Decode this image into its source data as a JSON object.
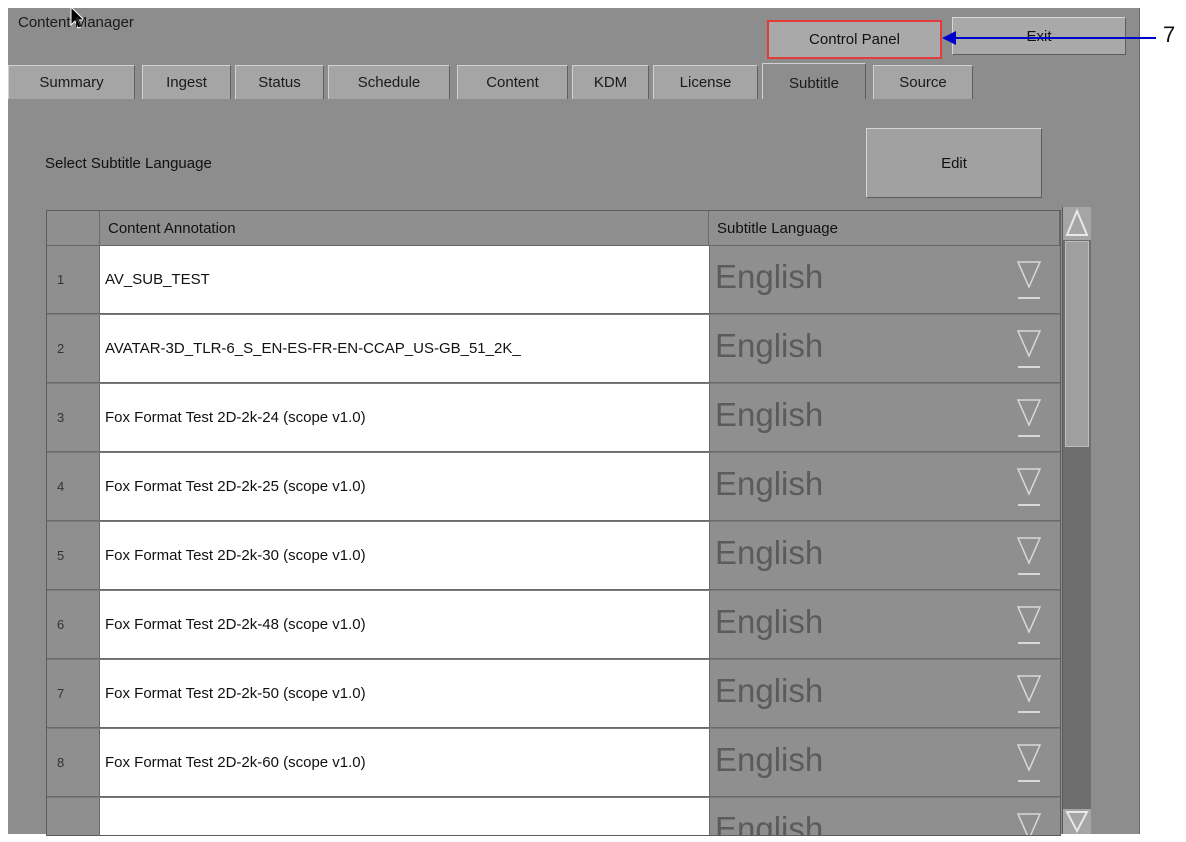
{
  "app": {
    "title": "Content Manager"
  },
  "header_buttons": {
    "control_panel": "Control Panel",
    "exit": "Exit"
  },
  "tabs": [
    {
      "label": "Summary",
      "active": false
    },
    {
      "label": "Ingest",
      "active": false
    },
    {
      "label": "Status",
      "active": false
    },
    {
      "label": "Schedule",
      "active": false
    },
    {
      "label": "Content",
      "active": false
    },
    {
      "label": "KDM",
      "active": false
    },
    {
      "label": "License",
      "active": false
    },
    {
      "label": "Subtitle",
      "active": true
    },
    {
      "label": "Source",
      "active": false
    }
  ],
  "subtitle_panel": {
    "section_label": "Select Subtitle Language",
    "edit_label": "Edit",
    "columns": {
      "annotation": "Content Annotation",
      "language": "Subtitle Language"
    },
    "rows": [
      {
        "num": "1",
        "annotation": "AV_SUB_TEST",
        "language": "English"
      },
      {
        "num": "2",
        "annotation": "AVATAR-3D_TLR-6_S_EN-ES-FR-EN-CCAP_US-GB_51_2K_",
        "language": "English"
      },
      {
        "num": "3",
        "annotation": "Fox Format Test 2D-2k-24 (scope v1.0)",
        "language": "English"
      },
      {
        "num": "4",
        "annotation": "Fox Format Test 2D-2k-25 (scope v1.0)",
        "language": "English"
      },
      {
        "num": "5",
        "annotation": "Fox Format Test 2D-2k-30 (scope v1.0)",
        "language": "English"
      },
      {
        "num": "6",
        "annotation": "Fox Format Test 2D-2k-48 (scope v1.0)",
        "language": "English"
      },
      {
        "num": "7",
        "annotation": "Fox Format Test 2D-2k-50 (scope v1.0)",
        "language": "English"
      },
      {
        "num": "8",
        "annotation": "Fox Format Test 2D-2k-60 (scope v1.0)",
        "language": "English"
      },
      {
        "num": "",
        "annotation": "",
        "language": "English"
      }
    ]
  },
  "annotation_callout": {
    "number": "7",
    "color": "#0000cc"
  },
  "highlight_color": "#e43a3a",
  "icons": {
    "cursor": "mouse-pointer-icon",
    "dropdown": "dropdown-triangle-icon",
    "scroll_up": "scroll-up-arrow-icon",
    "scroll_down": "scroll-down-arrow-icon"
  }
}
